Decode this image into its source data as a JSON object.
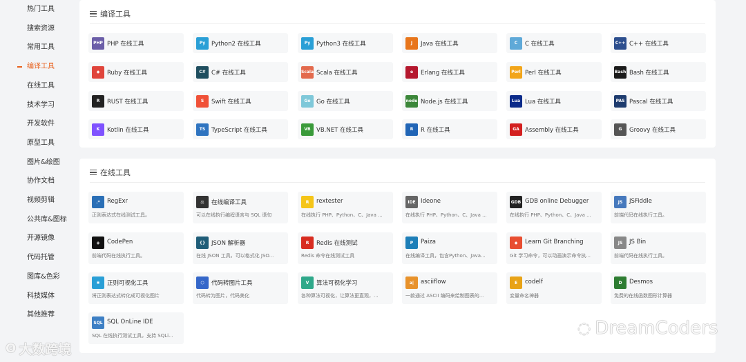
{
  "sidebar": {
    "items": [
      {
        "label": "热门工具"
      },
      {
        "label": "搜索资源"
      },
      {
        "label": "常用工具"
      },
      {
        "label": "编译工具",
        "active": true
      },
      {
        "label": "在线工具"
      },
      {
        "label": "技术学习"
      },
      {
        "label": "开发软件"
      },
      {
        "label": "原型工具"
      },
      {
        "label": "图片&绘图"
      },
      {
        "label": "协作文档"
      },
      {
        "label": "视频剪辑"
      },
      {
        "label": "公共库&图标"
      },
      {
        "label": "开源镜像"
      },
      {
        "label": "代码托管"
      },
      {
        "label": "图库&色彩"
      },
      {
        "label": "科技媒体"
      },
      {
        "label": "其他推荐"
      }
    ],
    "active_color": "#e8601c"
  },
  "compile_section": {
    "title": "编译工具",
    "cards": [
      {
        "label": "PHP 在线工具",
        "icon": "php-icon",
        "icon_text": "PHP",
        "color": "#6b5ea8"
      },
      {
        "label": "Python2 在线工具",
        "icon": "python2-icon",
        "icon_text": "Py",
        "color": "#2a9fd6"
      },
      {
        "label": "Python3 在线工具",
        "icon": "python3-icon",
        "icon_text": "Py",
        "color": "#2a9fd6"
      },
      {
        "label": "Java 在线工具",
        "icon": "java-icon",
        "icon_text": "J",
        "color": "#e8761c"
      },
      {
        "label": "C 在线工具",
        "icon": "c-icon",
        "icon_text": "C",
        "color": "#5fa9d8"
      },
      {
        "label": "C++ 在线工具",
        "icon": "cpp-icon",
        "icon_text": "C++",
        "color": "#2d4f8e"
      },
      {
        "label": "Ruby 在线工具",
        "icon": "ruby-icon",
        "icon_text": "◆",
        "color": "#e0453c"
      },
      {
        "label": "C# 在线工具",
        "icon": "csharp-icon",
        "icon_text": "C#",
        "color": "#1f4e5f"
      },
      {
        "label": "Scala 在线工具",
        "icon": "scala-icon",
        "icon_text": "Scala",
        "color": "#e36a4d"
      },
      {
        "label": "Erlang 在线工具",
        "icon": "erlang-icon",
        "icon_text": "e",
        "color": "#b5182e"
      },
      {
        "label": "Perl 在线工具",
        "icon": "perl-icon",
        "icon_text": "Perl",
        "color": "#f2a51a"
      },
      {
        "label": "Bash 在线工具",
        "icon": "bash-icon",
        "icon_text": "Bash",
        "color": "#1b1b1b"
      },
      {
        "label": "RUST 在线工具",
        "icon": "rust-icon",
        "icon_text": "R",
        "color": "#222222"
      },
      {
        "label": "Swift 在线工具",
        "icon": "swift-icon",
        "icon_text": "S",
        "color": "#f05138"
      },
      {
        "label": "Go 在线工具",
        "icon": "go-icon",
        "icon_text": "Go",
        "color": "#7fc8d9"
      },
      {
        "label": "Node.js 在线工具",
        "icon": "nodejs-icon",
        "icon_text": "node",
        "color": "#3c873a"
      },
      {
        "label": "Lua 在线工具",
        "icon": "lua-icon",
        "icon_text": "Lua",
        "color": "#0b2b8a"
      },
      {
        "label": "Pascal 在线工具",
        "icon": "pascal-icon",
        "icon_text": "PAS",
        "color": "#1d3b6e"
      },
      {
        "label": "Kotlin 在线工具",
        "icon": "kotlin-icon",
        "icon_text": "K",
        "color": "#7f52ff"
      },
      {
        "label": "TypeScript 在线工具",
        "icon": "typescript-icon",
        "icon_text": "TS",
        "color": "#2f74c0"
      },
      {
        "label": "VB.NET 在线工具",
        "icon": "vbnet-icon",
        "icon_text": "VB",
        "color": "#3a9a3a"
      },
      {
        "label": "R 在线工具",
        "icon": "r-icon",
        "icon_text": "R",
        "color": "#2165b6"
      },
      {
        "label": "Assembly 在线工具",
        "icon": "assembly-icon",
        "icon_text": "GA",
        "color": "#d32020"
      },
      {
        "label": "Groovy 在线工具",
        "icon": "groovy-icon",
        "icon_text": "G",
        "color": "#555555"
      }
    ]
  },
  "online_section": {
    "title": "在线工具",
    "cards": [
      {
        "label": "RegExr",
        "desc": "正则表达式在线测试工具。",
        "icon": "regexr-icon",
        "icon_text": ".*",
        "color": "#2a6fb6"
      },
      {
        "label": "在线编译工具",
        "desc": "可以在线执行编程语言与 SQL 语句",
        "icon": "gavel-icon",
        "icon_text": "⚖",
        "color": "#333333"
      },
      {
        "label": "rextester",
        "desc": "在线执行 PHP、Python、C、Java ...",
        "icon": "rextester-icon",
        "icon_text": "R",
        "color": "#f5c518"
      },
      {
        "label": "Ideone",
        "desc": "在线执行 PHP、Python、C、Java ...",
        "icon": "ideone-icon",
        "icon_text": "IDE",
        "color": "#666666"
      },
      {
        "label": "GDB online Debugger",
        "desc": "在线执行 PHP、Python、C、Java ...",
        "icon": "gdb-icon",
        "icon_text": "GDB",
        "color": "#222222"
      },
      {
        "label": "JSFiddle",
        "desc": "前端代码在线执行工具。",
        "icon": "jsfiddle-icon",
        "icon_text": "JS",
        "color": "#4679bd"
      },
      {
        "label": "CodePen",
        "desc": "前端代码在线执行工具。",
        "icon": "codepen-icon",
        "icon_text": "◈",
        "color": "#111111"
      },
      {
        "label": "JSON 解析器",
        "desc": "在线 JSON 工具，可以格式化 JSO...",
        "icon": "json-icon",
        "icon_text": "{}",
        "color": "#1f5d78"
      },
      {
        "label": "Redis 在线测试",
        "desc": "Redis 命令在线测试工具",
        "icon": "redis-icon",
        "icon_text": "R",
        "color": "#d82c20"
      },
      {
        "label": "Paiza",
        "desc": "在线编译工具，包含Python、Java...",
        "icon": "paiza-icon",
        "icon_text": "P",
        "color": "#1e7fb8"
      },
      {
        "label": "Learn Git Branching",
        "desc": "Git 学习命令，可以动画演示命令执...",
        "icon": "git-icon",
        "icon_text": "◆",
        "color": "#e84e31"
      },
      {
        "label": "JS Bin",
        "desc": "前端代码在线执行工具。",
        "icon": "jsbin-icon",
        "icon_text": "JS",
        "color": "#888888"
      },
      {
        "label": "正则可视化工具",
        "desc": "将正则表达式转化成可视化图片",
        "icon": "regex-visual-icon",
        "icon_text": "✱",
        "color": "#2a9fd6"
      },
      {
        "label": "代码转图片工具",
        "desc": "代码转为图片，代码美化",
        "icon": "carbon-icon",
        "icon_text": "⬡",
        "color": "#3567c9"
      },
      {
        "label": "算法可视化学习",
        "desc": "各种算法可视化，让算法更直观，...",
        "icon": "visualgo-icon",
        "icon_text": "V",
        "color": "#2fa88a"
      },
      {
        "label": "asciiflow",
        "desc": "一款通过 ASCII 编码来绘制图表的...",
        "icon": "asciiflow-icon",
        "icon_text": "a|",
        "color": "#e8922b"
      },
      {
        "label": "codelf",
        "desc": "变量命名神器",
        "icon": "codelf-icon",
        "icon_text": "E",
        "color": "#e8a317"
      },
      {
        "label": "Desmos",
        "desc": "免费的在线函数图形计算器",
        "icon": "desmos-icon",
        "icon_text": "D",
        "color": "#2e7d32"
      },
      {
        "label": "SQL OnLine IDE",
        "desc": "SQL 在线执行测试工具，支持 SQLi...",
        "icon": "sql-icon",
        "icon_text": "SQL",
        "color": "#3d7fc4"
      }
    ]
  },
  "watermarks": {
    "left": "大数跨境",
    "right": "DreamCoders"
  }
}
